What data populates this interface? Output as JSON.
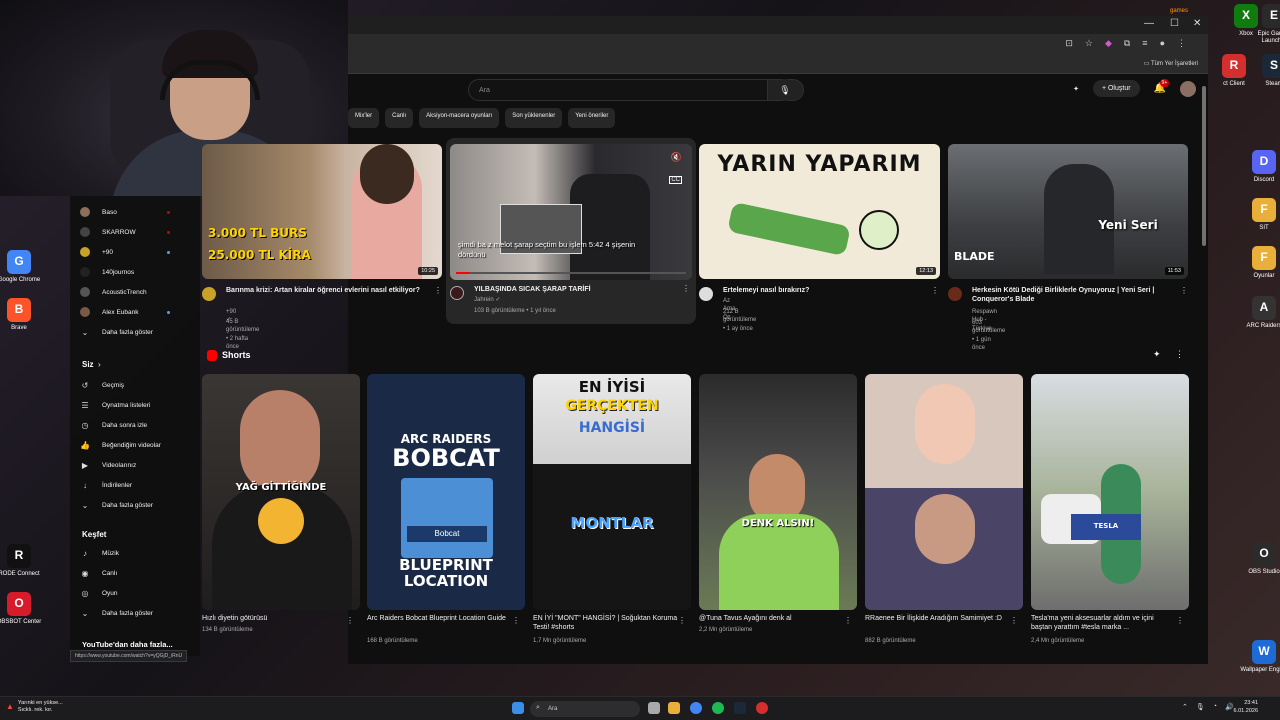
{
  "desktop": {
    "right_icons": [
      {
        "label": "Xbox",
        "color": "#107c10",
        "glyph": "X"
      },
      {
        "label": "Epic Games Launcher",
        "color": "#2a2a2a",
        "glyph": "E"
      },
      {
        "label": "ct Client",
        "color": "#d32f2f",
        "glyph": "R"
      },
      {
        "label": "Steam",
        "color": "#1b2838",
        "glyph": "S"
      },
      {
        "label": "Discord",
        "color": "#5865f2",
        "glyph": "D"
      },
      {
        "label": "SIT",
        "color": "#e8b03a",
        "glyph": "F"
      },
      {
        "label": "Oyunlar",
        "color": "#e8b03a",
        "glyph": "F"
      },
      {
        "label": "ARC Raiders",
        "color": "#333",
        "glyph": "A"
      },
      {
        "label": "OBS Studio",
        "color": "#2b2b2b",
        "glyph": "O"
      },
      {
        "label": "Wallpaper Engine",
        "color": "#1e6bd6",
        "glyph": "W"
      }
    ],
    "left_icons": [
      {
        "label": "Google Chrome",
        "color": "#4285f4",
        "glyph": "G"
      },
      {
        "label": "Brave",
        "color": "#fb542b",
        "glyph": "B"
      },
      {
        "label": "RODE Connect",
        "color": "#111",
        "glyph": "R"
      },
      {
        "label": "OBSBOT Center",
        "color": "#d81b2b",
        "glyph": "O"
      }
    ],
    "top_label": "games"
  },
  "browser": {
    "window_controls": [
      "—",
      "☐",
      "✕"
    ],
    "bookmarks_all": "Tüm Yer İşaretleri",
    "search_placeholder": "Ara",
    "create_label": "Oluştur",
    "notif_count": "9+"
  },
  "chips": [
    "Mix'ler",
    "Canlı",
    "Aksiyon-macera oyunları",
    "Son yüklenenler",
    "Yeni öneriler"
  ],
  "sidebar": {
    "subscriptions": [
      {
        "name": "Baso",
        "color": "#8b6f5a",
        "dot": "#cc0000"
      },
      {
        "name": "SKARROW",
        "color": "#444",
        "dot": "#cc0000"
      },
      {
        "name": "+90",
        "color": "#c9a227",
        "dot": "#3ea6ff"
      },
      {
        "name": "140journos",
        "color": "#222",
        "dot": ""
      },
      {
        "name": "AcousticTrench",
        "color": "#555",
        "dot": ""
      },
      {
        "name": "Alex Eubank",
        "color": "#7a5a45",
        "dot": "#3ea6ff"
      }
    ],
    "show_more_1": "Daha fazla göster",
    "you_heading": "Siz",
    "you_items": [
      {
        "label": "Geçmiş",
        "icon": "history-icon",
        "glyph": "↺"
      },
      {
        "label": "Oynatma listeleri",
        "icon": "playlist-icon",
        "glyph": "☰"
      },
      {
        "label": "Daha sonra izle",
        "icon": "watch-later-icon",
        "glyph": "◷"
      },
      {
        "label": "Beğendiğim videolar",
        "icon": "like-icon",
        "glyph": "👍"
      },
      {
        "label": "Videolarınız",
        "icon": "your-videos-icon",
        "glyph": "▶"
      },
      {
        "label": "İndirilenler",
        "icon": "download-icon",
        "glyph": "↓"
      }
    ],
    "show_more_2": "Daha fazla göster",
    "explore_heading": "Keşfet",
    "explore_items": [
      {
        "label": "Müzik",
        "icon": "music-icon",
        "glyph": "♪"
      },
      {
        "label": "Canlı",
        "icon": "live-icon",
        "glyph": "◉"
      },
      {
        "label": "Oyun",
        "icon": "gaming-icon",
        "glyph": "◎"
      }
    ],
    "show_more_3": "Daha fazla göster",
    "more_from_yt": "YouTube'dan daha fazla...",
    "status_url": "https://www.youtube.com/watch?v=yQGjD_iRnU"
  },
  "videos": [
    {
      "title": "Barınma krizi: Artan kiralar öğrenci evlerini nasıl etkiliyor?",
      "channel": "+90",
      "verified": true,
      "views": "45 B görüntüleme",
      "age": "2 hafta önce",
      "duration": "10:25",
      "overlay1": "3.000 TL BURS",
      "overlay2": "25.000 TL KİRA"
    },
    {
      "title": "YILBAŞINDA SICAK ŞARAP TARİFİ",
      "channel": "Jahrein",
      "verified": true,
      "views": "103 B görüntüleme",
      "age": "1 yıl önce",
      "subtitle": "şimdi ba              z melot şarap seçtim bu işlem 5:42 4 şişenin dördünü",
      "preview_time": "5:42"
    },
    {
      "title": "Ertelemeyi nasıl bırakırız?",
      "channel": "Az Ama Öz",
      "verified": false,
      "views": "212 B görüntüleme",
      "age": "1 ay önce",
      "duration": "12:13",
      "overlay": "YARIN YAPARIM"
    },
    {
      "title": "Herkesin Kötü Dediği Birliklerle Oynuyoruz | Yeni Seri | Conqueror's Blade",
      "channel": "Respawn Hub - Türkiye",
      "verified": false,
      "views": "603 görüntüleme",
      "age": "1 gün önce",
      "duration": "11:53",
      "overlay": "Yeni Seri",
      "logo": "BLADE"
    }
  ],
  "shorts_heading": "Shorts",
  "shorts": [
    {
      "title": "Hızlı diyetin götürüsü",
      "views": "134 B görüntüleme",
      "overlay": "YAĞ GİTTİĞİNDE"
    },
    {
      "title": "Arc Raiders Bobcat Blueprint Location Guide",
      "views": "168 B görüntüleme",
      "overlay1": "ARC RAIDERS",
      "overlay2": "BOBCAT",
      "overlay3": "BLUEPRINT LOCATION",
      "card": "Bobcat"
    },
    {
      "title": "EN İYİ \"MONT\" HANGİSİ? | Soğuktan Koruma Testi! #shorts",
      "views": "1,7 Mn görüntüleme",
      "overlay1": "EN İYİSİ",
      "overlay2": "GERÇEKTEN",
      "overlay3": "HANGİSİ",
      "overlay4": "MONTLAR"
    },
    {
      "title": "@Tuna Tavus Ayağını denk al",
      "views": "2,2 Mn görüntüleme",
      "overlay": "DENK ALSIN!"
    },
    {
      "title": "RRaenee Bir İlişkide Aradığım Samimiyet :D",
      "views": "882 B görüntüleme"
    },
    {
      "title": "Tesla'ma yeni aksesuarlar aldım ve içini baştan yarattım #tesla marka ...",
      "views": "2,4 Mn görüntüleme",
      "overlay": "TESLA"
    }
  ],
  "taskbar": {
    "weather_line1": "Yarınki en yükse...",
    "weather_line2": "Sıcklı. rek. kır.",
    "search": "Ara",
    "time": "23:41",
    "date": "6.01.2026"
  }
}
